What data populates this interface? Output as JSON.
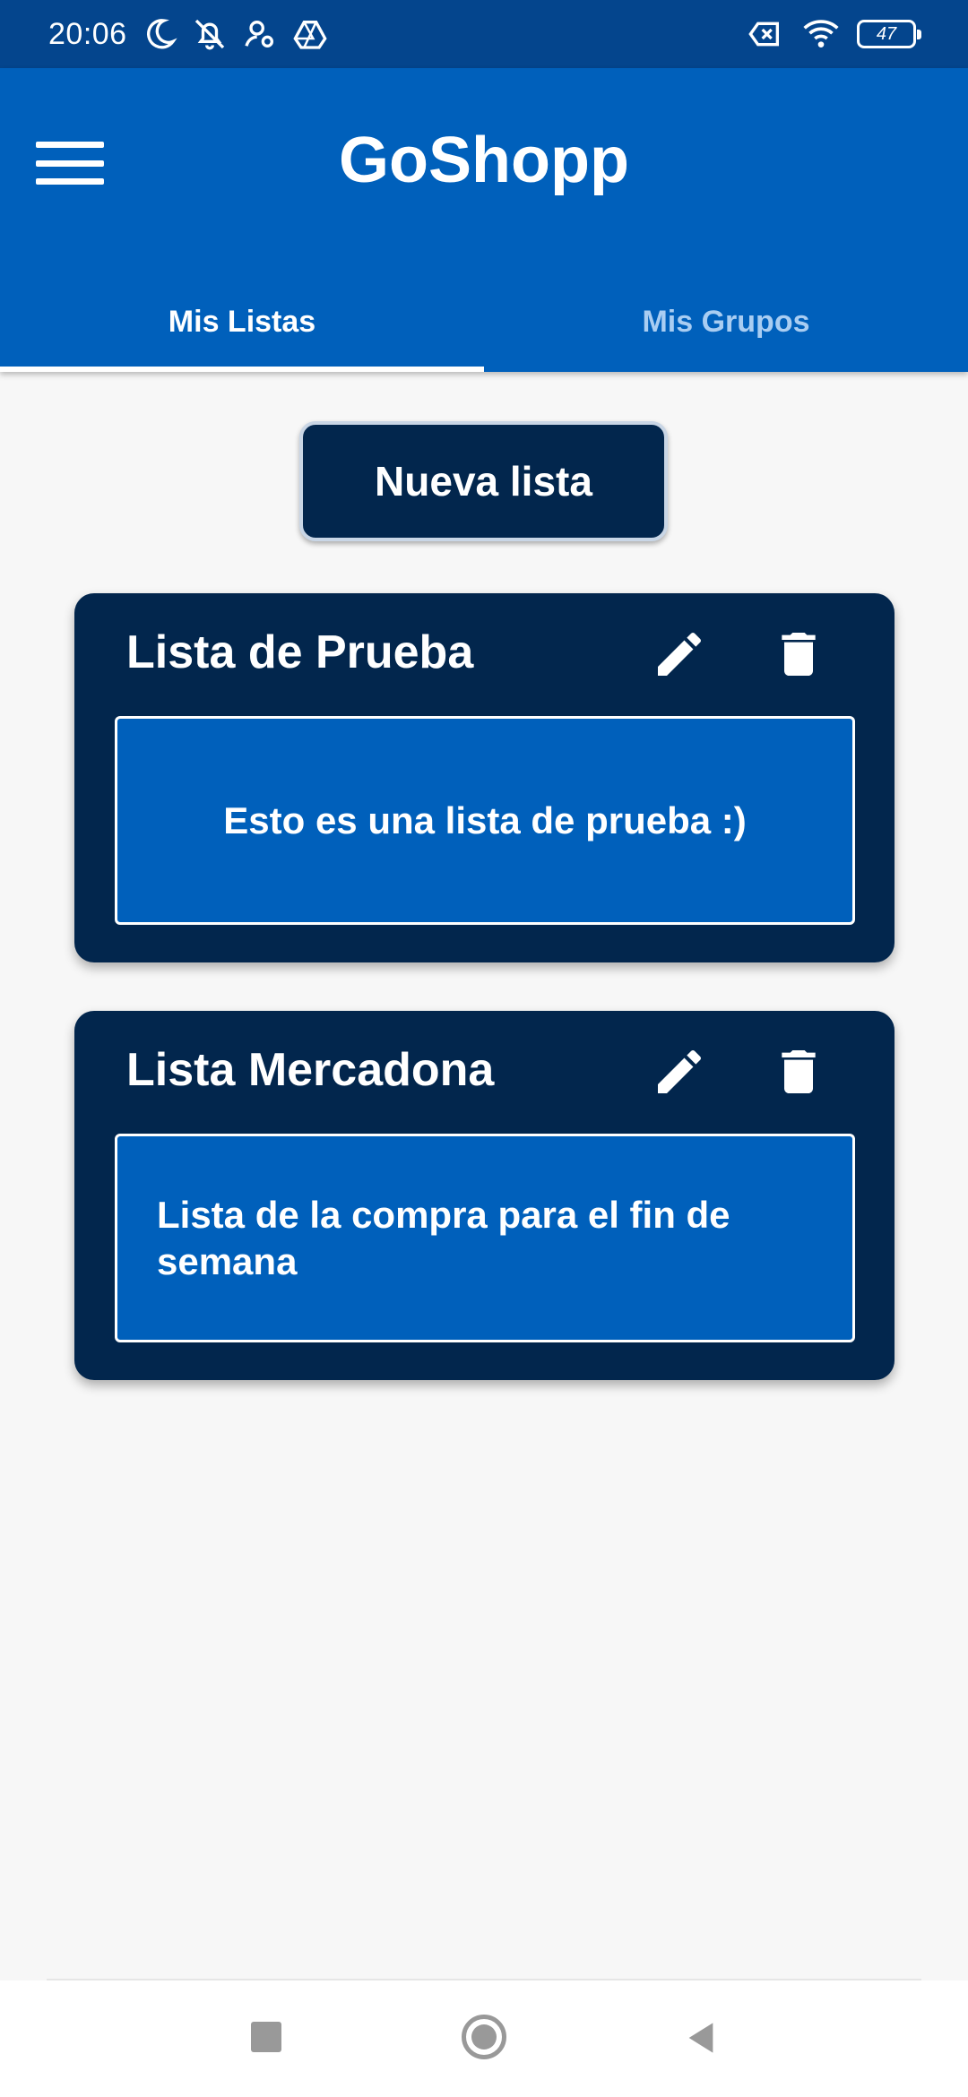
{
  "status_bar": {
    "time": "20:06",
    "left_icons": [
      "moon-icon",
      "bell-off-icon",
      "person-key-icon",
      "drive-icon"
    ],
    "right_icons": [
      "no-sim-icon",
      "wifi-icon",
      "battery-icon"
    ],
    "battery_level": "47"
  },
  "app_bar": {
    "title": "GoShopp",
    "menu_icon": "hamburger-menu-icon",
    "color": "#0060bb"
  },
  "tabs": [
    {
      "label": "Mis Listas",
      "active": true
    },
    {
      "label": "Mis Grupos",
      "active": false
    }
  ],
  "new_list_button": {
    "label": "Nueva lista"
  },
  "lists": [
    {
      "title": "Lista de Prueba",
      "description": "Esto es una lista de prueba :)",
      "edit_icon": "pencil-icon",
      "delete_icon": "trash-icon"
    },
    {
      "title": "Lista Mercadona",
      "description": "Lista de la compra para el fin de semana",
      "edit_icon": "pencil-icon",
      "delete_icon": "trash-icon"
    }
  ],
  "nav_bar": {
    "buttons": [
      "recents-square-icon",
      "home-circle-icon",
      "back-triangle-icon"
    ]
  },
  "colors": {
    "status_bar": "#04458d",
    "primary": "#0060bb",
    "card": "#02264d",
    "background": "#f7f7f7",
    "inactive_tab": "#a9cdf2"
  }
}
